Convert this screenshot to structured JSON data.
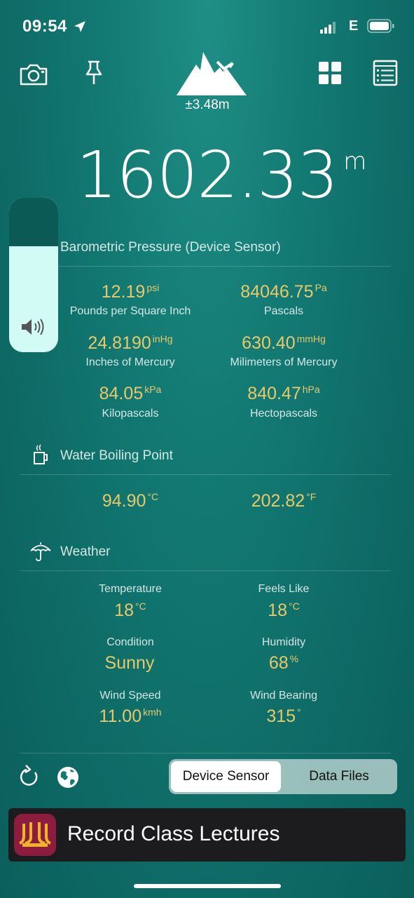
{
  "status_bar": {
    "time": "09:54",
    "network": "E"
  },
  "toolbar": {
    "accuracy": "±3.48m"
  },
  "altitude": {
    "value": "1602.33",
    "unit": "m"
  },
  "barometric": {
    "title": "Barometric Pressure (Device Sensor)",
    "items": [
      {
        "value": "12.19",
        "unit": "psi",
        "label": "Pounds per Square Inch"
      },
      {
        "value": "84046.75",
        "unit": "Pa",
        "label": "Pascals"
      },
      {
        "value": "24.8190",
        "unit": "inHg",
        "label": "Inches of Mercury"
      },
      {
        "value": "630.40",
        "unit": "mmHg",
        "label": "Milimeters of Mercury"
      },
      {
        "value": "84.05",
        "unit": "kPa",
        "label": "Kilopascals"
      },
      {
        "value": "840.47",
        "unit": "hPa",
        "label": "Hectopascals"
      }
    ]
  },
  "boiling": {
    "title": "Water Boiling Point",
    "celsius": {
      "value": "94.90",
      "unit": "°C"
    },
    "fahrenheit": {
      "value": "202.82",
      "unit": "°F"
    }
  },
  "weather": {
    "title": "Weather",
    "items": [
      {
        "label": "Temperature",
        "value": "18",
        "unit": "°C"
      },
      {
        "label": "Feels Like",
        "value": "18",
        "unit": "°C"
      },
      {
        "label": "Condition",
        "value": "Sunny",
        "unit": ""
      },
      {
        "label": "Humidity",
        "value": "68",
        "unit": "%"
      },
      {
        "label": "Wind Speed",
        "value": "11.00",
        "unit": "kmh"
      },
      {
        "label": "Wind Bearing",
        "value": "315",
        "unit": "°"
      }
    ]
  },
  "source_toggle": {
    "active": "Device Sensor",
    "other": "Data Files"
  },
  "ad": {
    "text": "Record Class Lectures"
  },
  "colors": {
    "accent_value": "#e9c86a",
    "background": "#137a73"
  }
}
